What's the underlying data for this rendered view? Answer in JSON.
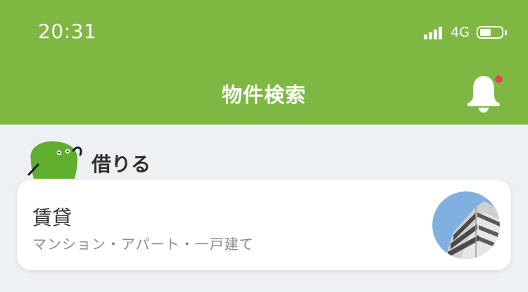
{
  "status_bar": {
    "time": "20:31",
    "network": "4G",
    "battery_level": 0.55,
    "signal_bars": 4
  },
  "header": {
    "title": "物件検索",
    "notification_icon": "bell-icon",
    "has_notification": true
  },
  "section": {
    "title": "借りる",
    "icon": "mascot-icon"
  },
  "card": {
    "title": "賃貸",
    "subtitle": "マンション・アパート・一戸建て",
    "image": "apartment-building-photo"
  },
  "colors": {
    "header_bg": "#7eb843",
    "page_bg": "#eef1f4",
    "badge": "#e14b4b",
    "mascot": "#5fae2e"
  }
}
